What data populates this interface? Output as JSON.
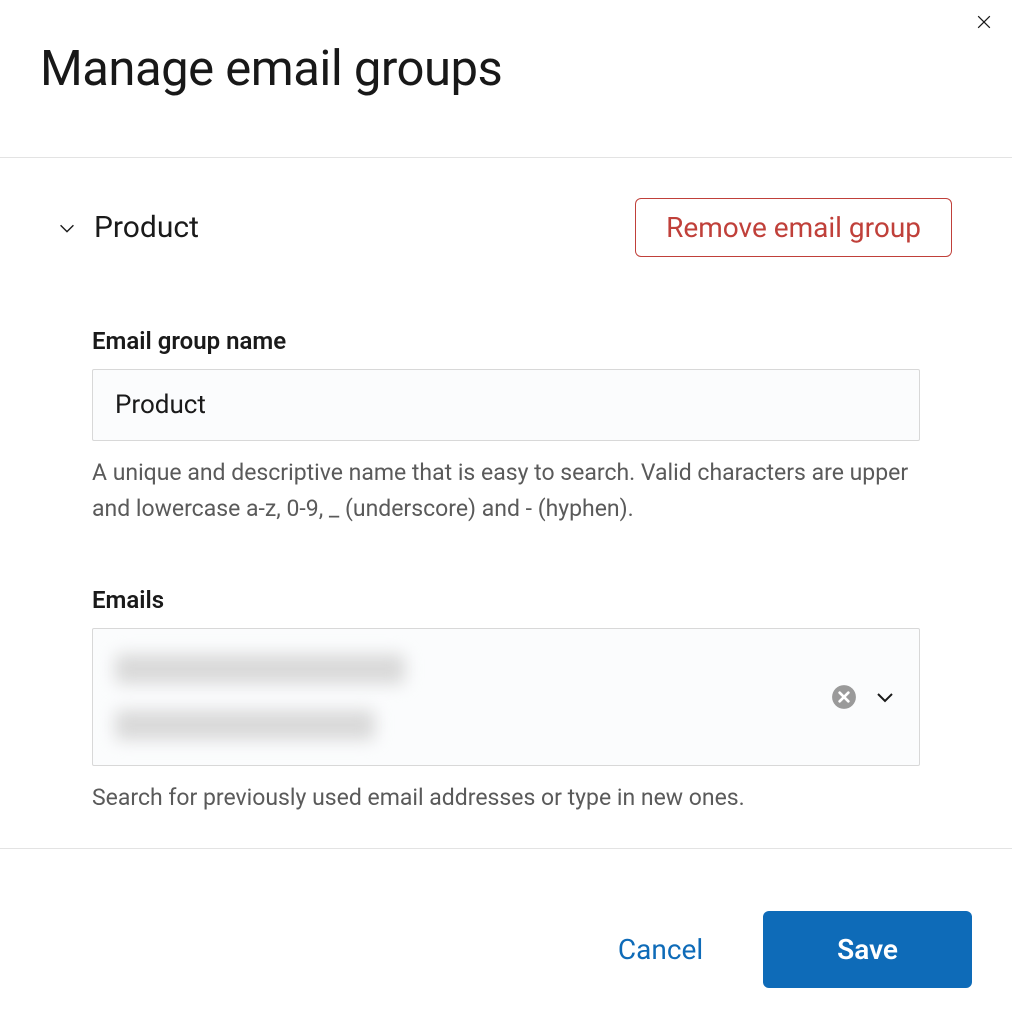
{
  "modal": {
    "title": "Manage email groups"
  },
  "section": {
    "title": "Product",
    "remove_label": "Remove email group"
  },
  "fields": {
    "name_label": "Email group name",
    "name_value": "Product",
    "name_help": "A unique and descriptive name that is easy to search. Valid characters are upper and lowercase a-z, 0-9, _ (underscore) and - (hyphen).",
    "emails_label": "Emails",
    "emails_help": "Search for previously used email addresses or type in new ones."
  },
  "footer": {
    "cancel_label": "Cancel",
    "save_label": "Save"
  }
}
